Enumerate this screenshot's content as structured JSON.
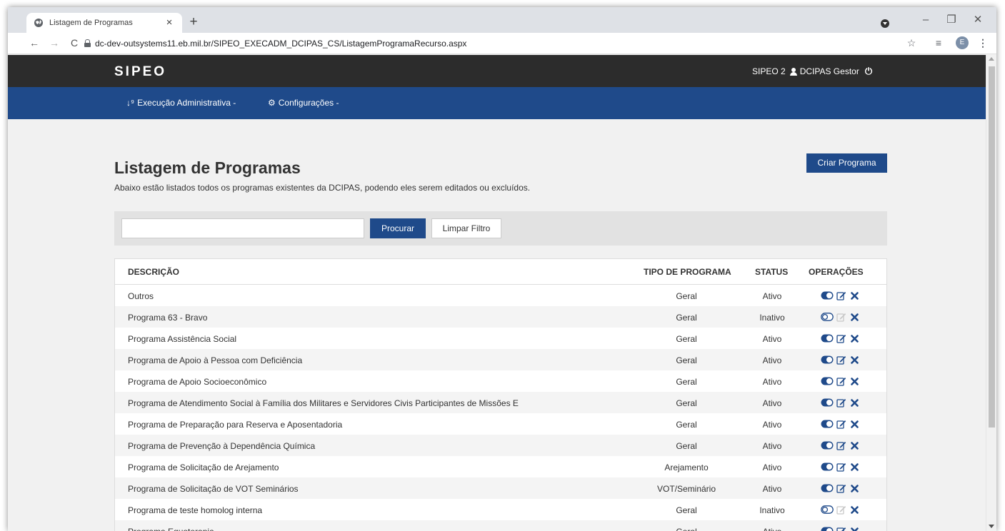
{
  "browser": {
    "tab_title": "Listagem de Programas",
    "new_tab": "+",
    "url": "dc-dev-outsystems11.eb.mil.br/SIPEO_EXECADM_DCIPAS_CS/ListagemProgramaRecurso.aspx",
    "profile_initial": "E",
    "icons": [
      "globe-icon",
      "close-icon",
      "back-icon",
      "forward-icon",
      "reload-icon",
      "lock-icon",
      "star-icon",
      "reading-list-icon",
      "menu-icon",
      "minimize-icon",
      "maximize-icon"
    ]
  },
  "header": {
    "logo": "SIPEO",
    "app_name": "SIPEO 2",
    "user": "DCIPAS Gestor",
    "background": "#2c2c2c"
  },
  "menu": {
    "items": [
      {
        "label": "Execução  Administrativa",
        "icon": "sort-numeric-icon"
      },
      {
        "label": "Configurações",
        "icon": "cogs-icon"
      }
    ],
    "background": "#1f4a8a"
  },
  "page": {
    "title": "Listagem de Programas",
    "description": "Abaixo estão listados todos os programas existentes da DCIPAS, podendo eles serem editados ou excluídos.",
    "create_button": "Criar Programa"
  },
  "filter": {
    "search_value": "",
    "search_button": "Procurar",
    "clear_button": "Limpar Filtro"
  },
  "table": {
    "columns": [
      "DESCRIÇÃO",
      "TIPO DE PROGRAMA",
      "STATUS",
      "OPERAÇÕES"
    ],
    "rows": [
      {
        "descricao": "Outros",
        "tipo": "Geral",
        "status": "Ativo"
      },
      {
        "descricao": "Programa 63 - Bravo",
        "tipo": "Geral",
        "status": "Inativo"
      },
      {
        "descricao": "Programa Assistência Social",
        "tipo": "Geral",
        "status": "Ativo"
      },
      {
        "descricao": "Programa de Apoio à Pessoa com Deficiência",
        "tipo": "Geral",
        "status": "Ativo"
      },
      {
        "descricao": "Programa de Apoio Socioeconômico",
        "tipo": "Geral",
        "status": "Ativo"
      },
      {
        "descricao": "Programa de Atendimento Social à Família dos Militares e Servidores Civis Participantes de Missões E",
        "tipo": "Geral",
        "status": "Ativo"
      },
      {
        "descricao": "Programa de Preparação para Reserva e Aposentadoria",
        "tipo": "Geral",
        "status": "Ativo"
      },
      {
        "descricao": "Programa de Prevenção à Dependência Química",
        "tipo": "Geral",
        "status": "Ativo"
      },
      {
        "descricao": "Programa de Solicitação de Arejamento",
        "tipo": "Arejamento",
        "status": "Ativo"
      },
      {
        "descricao": "Programa de Solicitação de VOT Seminários",
        "tipo": "VOT/Seminário",
        "status": "Ativo"
      },
      {
        "descricao": "Programa de teste homolog interna",
        "tipo": "Geral",
        "status": "Inativo"
      },
      {
        "descricao": "Programa Equoterapia",
        "tipo": "Geral",
        "status": "Ativo"
      }
    ],
    "active_color": "#1f4a8a",
    "inactive_color": "#c8c8c8"
  }
}
